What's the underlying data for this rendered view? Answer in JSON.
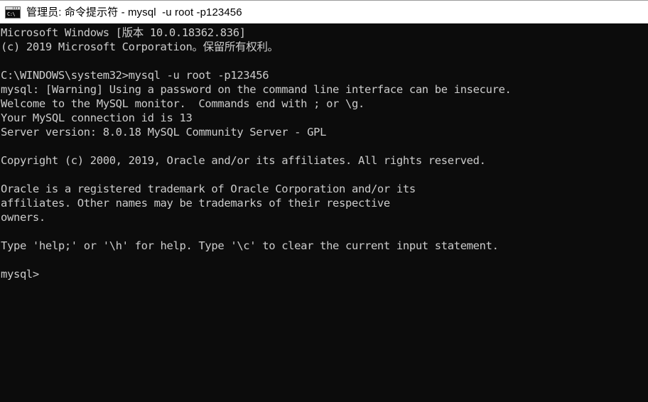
{
  "window": {
    "title": "管理员: 命令提示符 - mysql  -u root -p123456",
    "icon": "cmd-console-icon",
    "icon_glyph": "C:\\",
    "titlebar_bg": "#ffffff",
    "titlebar_text_color": "#000000",
    "console_bg": "#0c0c0c",
    "console_text_color": "#cccccc"
  },
  "console": {
    "lines": [
      "Microsoft Windows [版本 10.0.18362.836]",
      "(c) 2019 Microsoft Corporation。保留所有权利。",
      "",
      "C:\\WINDOWS\\system32>mysql -u root -p123456",
      "mysql: [Warning] Using a password on the command line interface can be insecure.",
      "Welcome to the MySQL monitor.  Commands end with ; or \\g.",
      "Your MySQL connection id is 13",
      "Server version: 8.0.18 MySQL Community Server - GPL",
      "",
      "Copyright (c) 2000, 2019, Oracle and/or its affiliates. All rights reserved.",
      "",
      "Oracle is a registered trademark of Oracle Corporation and/or its",
      "affiliates. Other names may be trademarks of their respective",
      "owners.",
      "",
      "Type 'help;' or '\\h' for help. Type '\\c' to clear the current input statement.",
      "",
      "mysql>"
    ]
  }
}
